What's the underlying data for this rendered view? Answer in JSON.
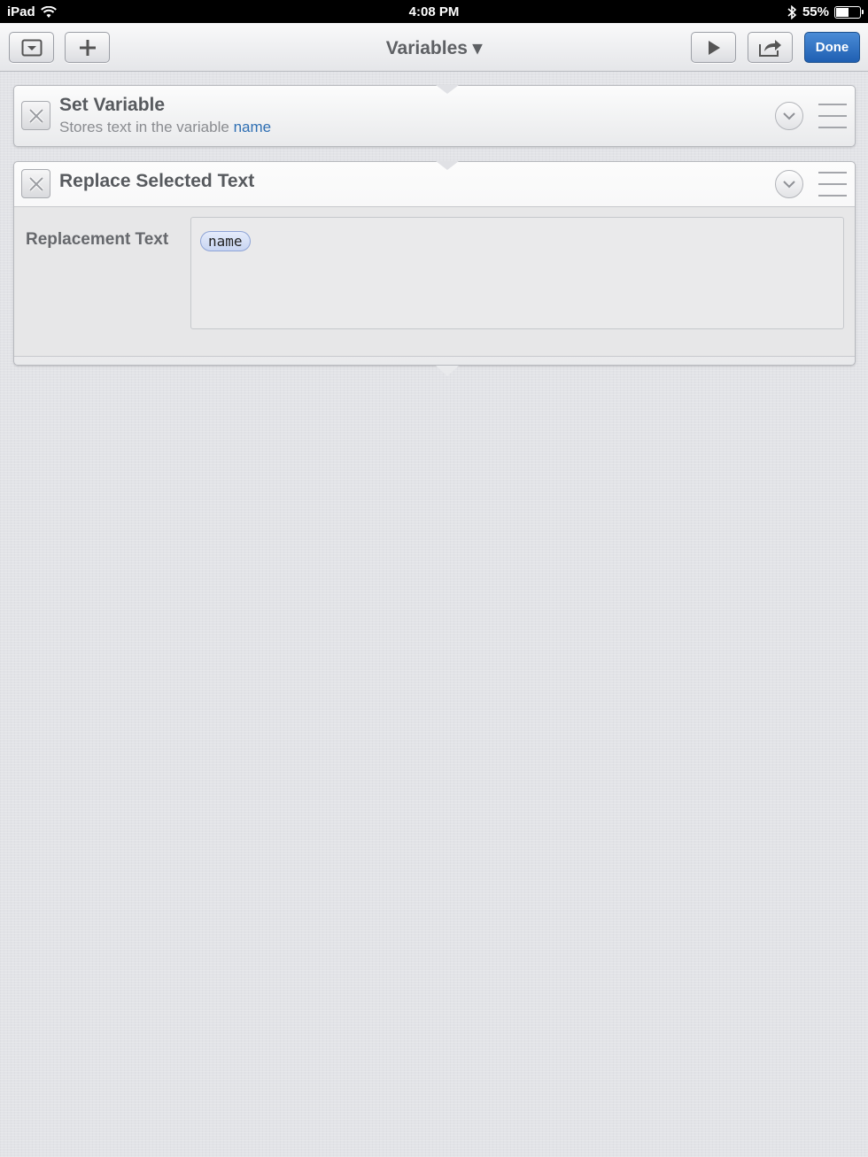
{
  "status_bar": {
    "device": "iPad",
    "time": "4:08 PM",
    "battery_percent": "55%",
    "battery_level": 0.55
  },
  "toolbar": {
    "title": "Variables ▾",
    "done_label": "Done",
    "left_buttons": [
      "collapse-icon",
      "plus-icon"
    ],
    "right_buttons": [
      "play-icon",
      "share-icon"
    ]
  },
  "actions": [
    {
      "title": "Set Variable",
      "subtitle_prefix": "Stores text in the variable",
      "subtitle_var": "name"
    },
    {
      "title": "Replace Selected Text",
      "param_label": "Replacement Text",
      "token": "name"
    }
  ],
  "colors": {
    "done_button": "#1f5fb2",
    "variable_link": "#2f6fb3",
    "token_bg": "#c8d5f2"
  }
}
